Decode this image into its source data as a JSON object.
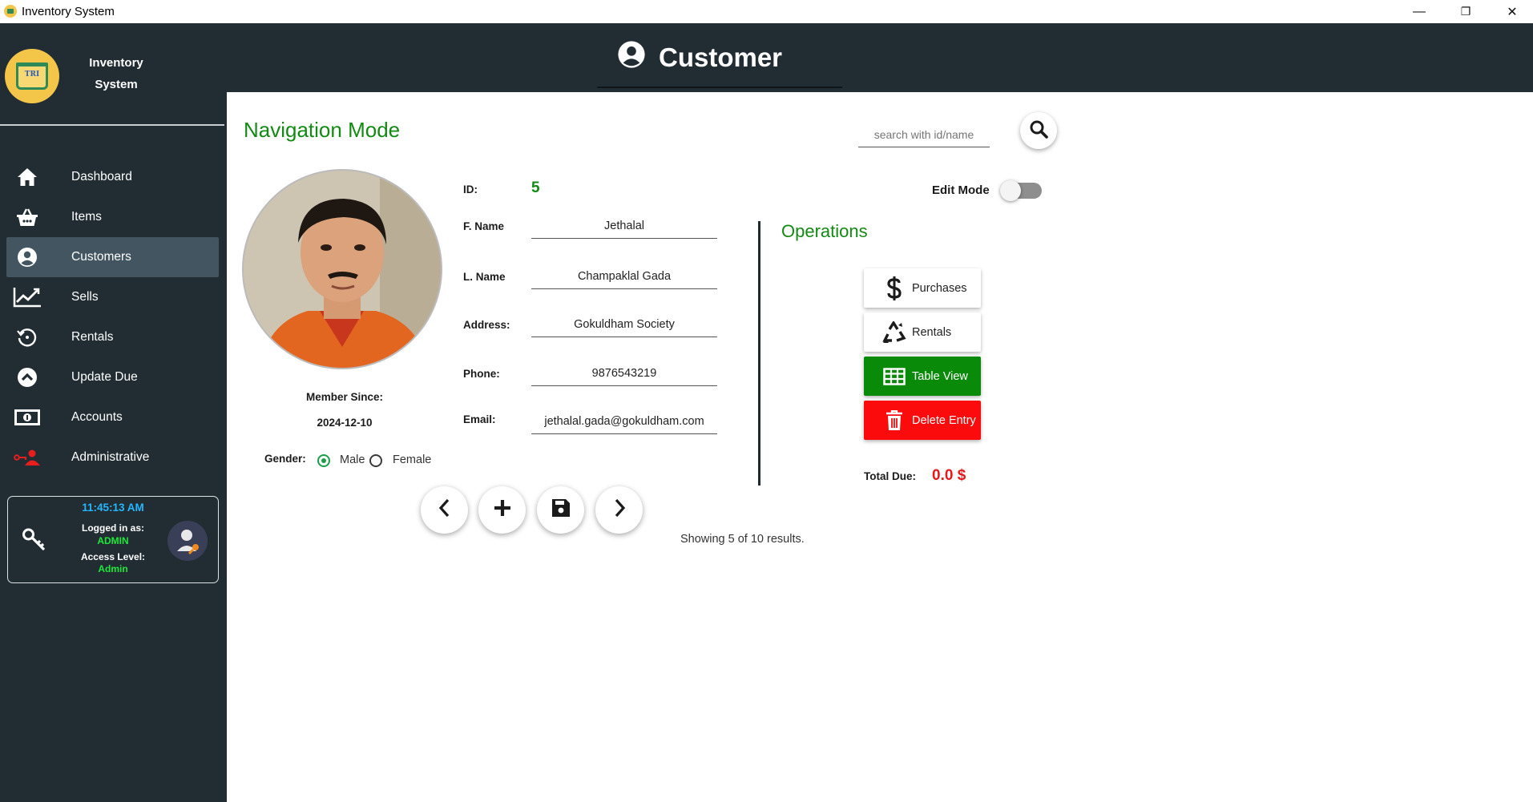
{
  "window": {
    "title": "Inventory System",
    "minimize": "—",
    "maximize": "❐",
    "close": "✕"
  },
  "sidebar": {
    "brand_line1": "Inventory",
    "brand_line2": "System",
    "logo_text": "TRI",
    "items": [
      {
        "label": "Dashboard",
        "icon": "home-icon"
      },
      {
        "label": "Items",
        "icon": "basket-icon"
      },
      {
        "label": "Customers",
        "icon": "user-circle-icon",
        "active": true
      },
      {
        "label": "Sells",
        "icon": "chart-line-icon"
      },
      {
        "label": "Rentals",
        "icon": "history-icon"
      },
      {
        "label": "Update Due",
        "icon": "chevron-up-circle-icon"
      },
      {
        "label": "Accounts",
        "icon": "money-icon"
      },
      {
        "label": "Administrative",
        "icon": "admin-key-icon"
      }
    ],
    "status": {
      "time": "11:45:13 AM",
      "logged_label": "Logged in as:",
      "logged_value": "ADMIN",
      "access_label": "Access Level:",
      "access_value": "Admin"
    }
  },
  "header": {
    "title": "Customer"
  },
  "main": {
    "mode_title": "Navigation Mode",
    "search_placeholder": "search with id/name",
    "member_since_label": "Member Since:",
    "member_since_value": "2024-12-10",
    "gender_label": "Gender:",
    "gender_options": [
      "Male",
      "Female"
    ],
    "gender_selected": "Male",
    "fields": {
      "id_label": "ID:",
      "id_value": "5",
      "fname_label": "F. Name",
      "fname_value": "Jethalal",
      "lname_label": "L. Name",
      "lname_value": "Champaklal Gada",
      "address_label": "Address:",
      "address_value": "Gokuldham Society",
      "phone_label": "Phone:",
      "phone_value": "9876543219",
      "email_label": "Email:",
      "email_value": "jethalal.gada@gokuldham.com"
    },
    "edit_mode_label": "Edit Mode",
    "edit_mode_on": false,
    "operations_title": "Operations",
    "operations": {
      "purchases": "Purchases",
      "rentals": "Rentals",
      "table_view": "Table View",
      "delete_entry": "Delete Entry"
    },
    "total_due_label": "Total Due:",
    "total_due_value": "0.0 $",
    "results_text": "Showing 5 of 10 results."
  },
  "colors": {
    "sidebar_bg": "#222d33",
    "active_item_bg": "#425560",
    "green_accent": "#138a13",
    "table_view_bg": "#098a09",
    "delete_bg": "#fb0b0b",
    "time_color": "#23b7ff",
    "status_green": "#1ee83a",
    "due_red": "#e8171b"
  }
}
